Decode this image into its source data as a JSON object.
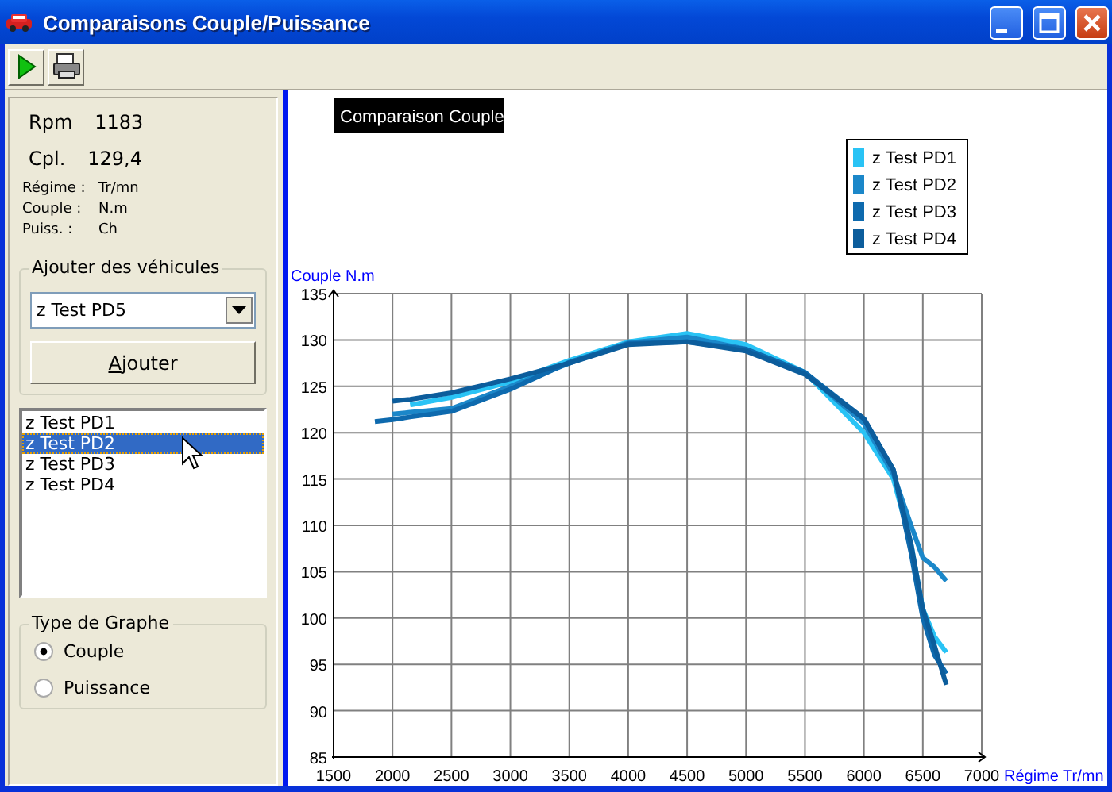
{
  "window": {
    "title": "Comparaisons Couple/Puissance",
    "controls": [
      {
        "kind": "minimize"
      },
      {
        "kind": "maximize"
      },
      {
        "kind": "close"
      }
    ]
  },
  "toolbar": [
    {
      "kind": "play"
    },
    {
      "kind": "print"
    }
  ],
  "readouts": [
    {
      "label": "Rpm",
      "value": "1183"
    },
    {
      "label": "Cpl.",
      "value": "129,4"
    }
  ],
  "units": [
    {
      "label": "Régime :",
      "unit": "Tr/mn"
    },
    {
      "label": "Couple :",
      "unit": "N.m"
    },
    {
      "label": "Puiss. :",
      "unit": "Ch"
    }
  ],
  "add_vehicles": {
    "title": "Ajouter des véhicules",
    "combo_value": "z Test PD5",
    "button": "Ajouter"
  },
  "vehicle_list": [
    {
      "label": "z Test PD1",
      "selected": false
    },
    {
      "label": "z Test PD2",
      "selected": true
    },
    {
      "label": "z Test PD3",
      "selected": false
    },
    {
      "label": "z Test PD4",
      "selected": false
    }
  ],
  "graph_type": {
    "title": "Type de Graphe",
    "options": [
      {
        "label": "Couple",
        "selected": true
      },
      {
        "label": "Puissance",
        "selected": false
      }
    ]
  },
  "chart": {
    "chart_data": {
      "type": "line",
      "title": "Comparaison Couple",
      "xlabel": "Régime Tr/mn",
      "ylabel": "Couple N.m",
      "x": [
        1850,
        2000,
        2150,
        2500,
        3000,
        3500,
        4000,
        4500,
        5000,
        5500,
        6000,
        6250,
        6400,
        6500,
        6600,
        6700
      ],
      "series": [
        {
          "name": "z Test PD1",
          "color": "#29c3f5",
          "values": [
            null,
            null,
            123,
            123.8,
            125.5,
            127.8,
            129.8,
            130.7,
            129.5,
            126.5,
            120,
            115,
            108,
            101,
            98,
            96.3
          ]
        },
        {
          "name": "z Test PD2",
          "color": "#1b87c9",
          "values": [
            null,
            122,
            122.2,
            122.6,
            125,
            127.5,
            129.7,
            130.3,
            129,
            126.5,
            121,
            115.5,
            110,
            106.5,
            105.5,
            104
          ]
        },
        {
          "name": "z Test PD3",
          "color": "#0e6aae",
          "values": [
            121.2,
            121.4,
            121.7,
            122.3,
            124.7,
            127.6,
            129.6,
            129.8,
            129,
            126.5,
            121.5,
            116,
            107,
            100,
            96,
            94
          ]
        },
        {
          "name": "z Test PD4",
          "color": "#0c5d9c",
          "values": [
            null,
            123.4,
            123.6,
            124.3,
            125.8,
            127.5,
            129.5,
            129.8,
            128.8,
            126.3,
            121.5,
            116,
            108,
            101,
            97,
            92.8
          ]
        }
      ],
      "grid": true,
      "legend": true,
      "xlim": [
        1500,
        7000
      ],
      "ylim": [
        85,
        135
      ],
      "xticks": [
        1500,
        2000,
        2500,
        3000,
        3500,
        4000,
        4500,
        5000,
        5500,
        6000,
        6500,
        7000
      ],
      "yticks": [
        85,
        90,
        95,
        100,
        105,
        110,
        115,
        120,
        125,
        130,
        135
      ]
    }
  }
}
